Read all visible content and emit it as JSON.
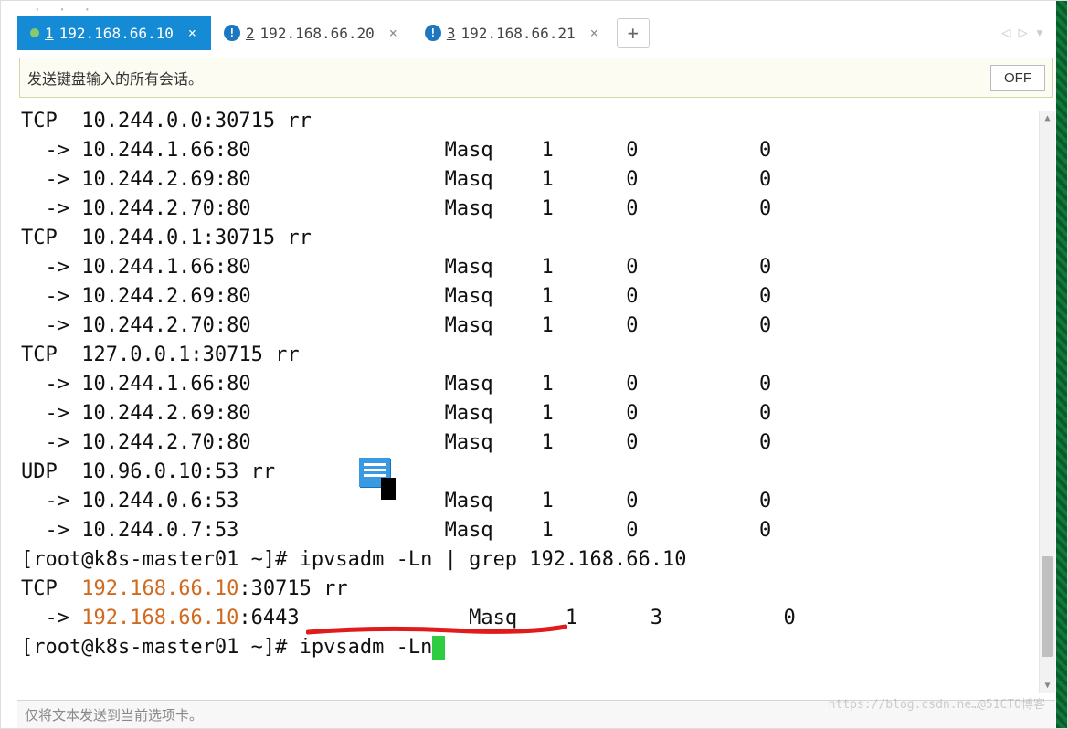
{
  "titlebar_dots": "· · ·",
  "tabs": [
    {
      "prefix": "1",
      "label": "192.168.66.10",
      "active": true,
      "has_info": false,
      "has_dot": true
    },
    {
      "prefix": "2",
      "label": "192.168.66.20",
      "active": false,
      "has_info": true,
      "has_dot": false
    },
    {
      "prefix": "3",
      "label": "192.168.66.21",
      "active": false,
      "has_info": true,
      "has_dot": false
    }
  ],
  "new_tab_glyph": "+",
  "tab_nav": {
    "left": "◁",
    "right": "▷",
    "down": "▾"
  },
  "infostrip": {
    "msg": "发送键盘输入的所有会话。",
    "btn": "OFF"
  },
  "scroll": {
    "up": "▲",
    "down": "▼"
  },
  "terminal": {
    "lines": [
      "TCP  10.244.0.0:30715 rr",
      "  -> 10.244.1.66:80                Masq    1      0          0",
      "  -> 10.244.2.69:80                Masq    1      0          0",
      "  -> 10.244.2.70:80                Masq    1      0          0",
      "TCP  10.244.0.1:30715 rr",
      "  -> 10.244.1.66:80                Masq    1      0          0",
      "  -> 10.244.2.69:80                Masq    1      0          0",
      "  -> 10.244.2.70:80                Masq    1      0          0",
      "TCP  127.0.0.1:30715 rr",
      "  -> 10.244.1.66:80                Masq    1      0          0",
      "  -> 10.244.2.69:80                Masq    1      0          0",
      "  -> 10.244.2.70:80                Masq    1      0          0",
      "UDP  10.96.0.10:53 rr",
      "  -> 10.244.0.6:53                 Masq    1      0          0",
      "  -> 10.244.0.7:53                 Masq    1      0          0"
    ],
    "cmd1_prompt": "[root@k8s-master01 ~]# ",
    "cmd1_cmd": "ipvsadm -Ln | grep 192.168.66.10",
    "grep_line1_a": "TCP  ",
    "grep_line1_hl": "192.168.66.10",
    "grep_line1_b": ":30715 rr",
    "grep_line2_a": "  -> ",
    "grep_line2_hl": "192.168.66.10",
    "grep_line2_b": ":6443              Masq    1      3          0",
    "cmd2_prompt": "[root@k8s-master01 ~]# ",
    "cmd2_cmd": "ipvsadm -Ln"
  },
  "info_glyph": "!",
  "close_glyph": "×",
  "bottom_text": "仅将文本发送到当前选项卡。",
  "watermark": "https://blog.csdn.ne…@51CTO博客"
}
